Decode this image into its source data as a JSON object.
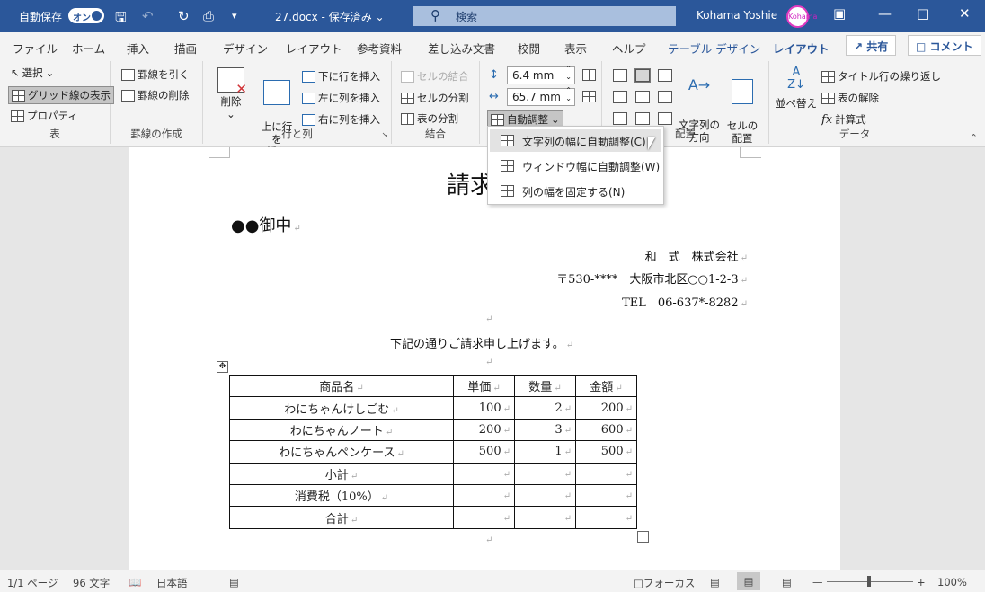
{
  "titlebar": {
    "autosave_label": "自動保存",
    "autosave_toggle": "オン",
    "doc_title": "27.docx - 保存済み",
    "doc_title_caret": "⌄",
    "search_placeholder": "検索",
    "user_name": "Kohama Yoshie",
    "avatar_text": "Kohama",
    "colors": {
      "bar": "#2b579a"
    }
  },
  "tabs": [
    {
      "label": "ファイル"
    },
    {
      "label": "ホーム"
    },
    {
      "label": "挿入"
    },
    {
      "label": "描画"
    },
    {
      "label": "デザイン"
    },
    {
      "label": "レイアウト"
    },
    {
      "label": "参考資料"
    },
    {
      "label": "差し込み文書"
    },
    {
      "label": "校閲"
    },
    {
      "label": "表示"
    },
    {
      "label": "ヘルプ"
    },
    {
      "label": "テーブル デザイン"
    },
    {
      "label": "レイアウト"
    }
  ],
  "share_label": "共有",
  "comment_label": "コメント",
  "ribbon": {
    "table": {
      "select": "選択",
      "gridlines": "グリッド線の表示",
      "properties": "プロパティ",
      "label": "表"
    },
    "draw": {
      "draw_border": "罫線を引く",
      "erase": "罫線の削除",
      "label": "罫線の作成"
    },
    "rows": {
      "delete": "削除",
      "insert_above": "上に行を\n挿入",
      "insert_below": "下に行を挿入",
      "insert_left": "左に列を挿入",
      "insert_right": "右に列を挿入",
      "label": "行と列"
    },
    "merge": {
      "merge_cells": "セルの結合",
      "split_cells": "セルの分割",
      "split_table": "表の分割",
      "label": "結合"
    },
    "size": {
      "height": "6.4 mm",
      "width": "65.7 mm",
      "autofit": "自動調整"
    },
    "align": {
      "text_direction": "文字列の\n方向",
      "cell_margins": "セルの\n配置",
      "label": "配置"
    },
    "data": {
      "sort": "並べ替え",
      "repeat_header": "タイトル行の繰り返し",
      "convert": "表の解除",
      "formula": "計算式",
      "label": "データ"
    }
  },
  "autofit_menu": [
    {
      "label": "文字列の幅に自動調整(C)"
    },
    {
      "label": "ウィンドウ幅に自動調整(W)"
    },
    {
      "label": "列の幅を固定する(N)"
    }
  ],
  "document": {
    "title": "請求",
    "recipient": "●●御中",
    "company": "和　式　株式会社",
    "address": "〒530-****　大阪市北区○○1-2-3",
    "tel": "TEL　06-637*-8282",
    "message": "下記の通りご請求申し上げます。",
    "table": {
      "headers": [
        "商品名",
        "単価",
        "数量",
        "金額"
      ],
      "rows": [
        [
          "わにちゃんけしごむ",
          "100",
          "2",
          "200"
        ],
        [
          "わにちゃんノート",
          "200",
          "3",
          "600"
        ],
        [
          "わにちゃんペンケース",
          "500",
          "1",
          "500"
        ],
        [
          "小計",
          "",
          "",
          ""
        ],
        [
          "消費税（10%）",
          "",
          "",
          ""
        ],
        [
          "合計",
          "",
          "",
          ""
        ]
      ]
    }
  },
  "status": {
    "page": "1/1 ページ",
    "words": "96 文字",
    "language": "日本語",
    "focus": "フォーカス",
    "zoom": "100%"
  }
}
